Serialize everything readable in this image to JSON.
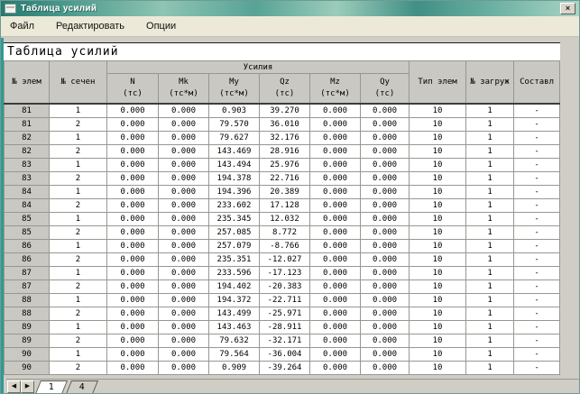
{
  "window": {
    "title": "Таблица усилий",
    "close_glyph": "×"
  },
  "menu": {
    "items": [
      {
        "label": "Файл"
      },
      {
        "label": "Редактировать"
      },
      {
        "label": "Опции"
      }
    ]
  },
  "panel": {
    "heading": "Таблица усилий"
  },
  "colors": {
    "titlebar_teal": "#4c9c8e",
    "menu_bg": "#ece9d8",
    "window_bg": "#cfcdc5",
    "header_bg": "#c9c8c2"
  },
  "table": {
    "corner_headers": [
      {
        "label": "№ элем"
      },
      {
        "label": "№ сечен"
      }
    ],
    "group_header": "Усилия",
    "force_columns": [
      {
        "name": "N",
        "unit": "(тс)"
      },
      {
        "name": "Mk",
        "unit": "(тс*м)"
      },
      {
        "name": "My",
        "unit": "(тс*м)"
      },
      {
        "name": "Qz",
        "unit": "(тс)"
      },
      {
        "name": "Mz",
        "unit": "(тс*м)"
      },
      {
        "name": "Qy",
        "unit": "(тс)"
      }
    ],
    "right_headers": [
      {
        "label": "Тип элем"
      },
      {
        "label": "№ загруж"
      },
      {
        "label": "Составл"
      }
    ],
    "rows": [
      [
        "81",
        "1",
        "0.000",
        "0.000",
        "0.903",
        "39.270",
        "0.000",
        "0.000",
        "10",
        "1",
        "-"
      ],
      [
        "81",
        "2",
        "0.000",
        "0.000",
        "79.570",
        "36.010",
        "0.000",
        "0.000",
        "10",
        "1",
        "-"
      ],
      [
        "82",
        "1",
        "0.000",
        "0.000",
        "79.627",
        "32.176",
        "0.000",
        "0.000",
        "10",
        "1",
        "-"
      ],
      [
        "82",
        "2",
        "0.000",
        "0.000",
        "143.469",
        "28.916",
        "0.000",
        "0.000",
        "10",
        "1",
        "-"
      ],
      [
        "83",
        "1",
        "0.000",
        "0.000",
        "143.494",
        "25.976",
        "0.000",
        "0.000",
        "10",
        "1",
        "-"
      ],
      [
        "83",
        "2",
        "0.000",
        "0.000",
        "194.378",
        "22.716",
        "0.000",
        "0.000",
        "10",
        "1",
        "-"
      ],
      [
        "84",
        "1",
        "0.000",
        "0.000",
        "194.396",
        "20.389",
        "0.000",
        "0.000",
        "10",
        "1",
        "-"
      ],
      [
        "84",
        "2",
        "0.000",
        "0.000",
        "233.602",
        "17.128",
        "0.000",
        "0.000",
        "10",
        "1",
        "-"
      ],
      [
        "85",
        "1",
        "0.000",
        "0.000",
        "235.345",
        "12.032",
        "0.000",
        "0.000",
        "10",
        "1",
        "-"
      ],
      [
        "85",
        "2",
        "0.000",
        "0.000",
        "257.085",
        "8.772",
        "0.000",
        "0.000",
        "10",
        "1",
        "-"
      ],
      [
        "86",
        "1",
        "0.000",
        "0.000",
        "257.079",
        "-8.766",
        "0.000",
        "0.000",
        "10",
        "1",
        "-"
      ],
      [
        "86",
        "2",
        "0.000",
        "0.000",
        "235.351",
        "-12.027",
        "0.000",
        "0.000",
        "10",
        "1",
        "-"
      ],
      [
        "87",
        "1",
        "0.000",
        "0.000",
        "233.596",
        "-17.123",
        "0.000",
        "0.000",
        "10",
        "1",
        "-"
      ],
      [
        "87",
        "2",
        "0.000",
        "0.000",
        "194.402",
        "-20.383",
        "0.000",
        "0.000",
        "10",
        "1",
        "-"
      ],
      [
        "88",
        "1",
        "0.000",
        "0.000",
        "194.372",
        "-22.711",
        "0.000",
        "0.000",
        "10",
        "1",
        "-"
      ],
      [
        "88",
        "2",
        "0.000",
        "0.000",
        "143.499",
        "-25.971",
        "0.000",
        "0.000",
        "10",
        "1",
        "-"
      ],
      [
        "89",
        "1",
        "0.000",
        "0.000",
        "143.463",
        "-28.911",
        "0.000",
        "0.000",
        "10",
        "1",
        "-"
      ],
      [
        "89",
        "2",
        "0.000",
        "0.000",
        "79.632",
        "-32.171",
        "0.000",
        "0.000",
        "10",
        "1",
        "-"
      ],
      [
        "90",
        "1",
        "0.000",
        "0.000",
        "79.564",
        "-36.004",
        "0.000",
        "0.000",
        "10",
        "1",
        "-"
      ],
      [
        "90",
        "2",
        "0.000",
        "0.000",
        "0.909",
        "-39.264",
        "0.000",
        "0.000",
        "10",
        "1",
        "-"
      ]
    ]
  },
  "sheet_tabs": {
    "prev_glyph": "◀",
    "next_glyph": "▶",
    "tabs": [
      {
        "label": "1"
      },
      {
        "label": "4"
      }
    ]
  }
}
